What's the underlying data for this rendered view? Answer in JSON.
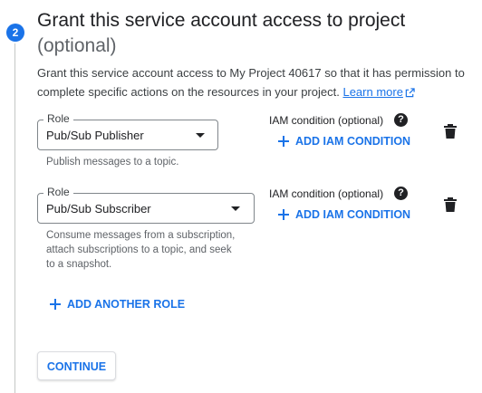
{
  "step": {
    "number": "2",
    "title": "Grant this service account access to project",
    "optional": "(optional)",
    "description_text": "Grant this service account access to My Project 40617 so that it has permission to complete specific actions on the resources in your project.",
    "learn_more": "Learn more"
  },
  "roles": [
    {
      "label": "Role",
      "value": "Pub/Sub Publisher",
      "hint": "Publish messages to a topic.",
      "iam_condition_label": "IAM condition (optional)",
      "add_iam_condition": "ADD IAM CONDITION",
      "help_glyph": "?"
    },
    {
      "label": "Role",
      "value": "Pub/Sub Subscriber",
      "hint": "Consume messages from a subscription, attach subscriptions to a topic, and seek to a snapshot.",
      "iam_condition_label": "IAM condition (optional)",
      "add_iam_condition": "ADD IAM CONDITION",
      "help_glyph": "?"
    }
  ],
  "add_another_role": "ADD ANOTHER ROLE",
  "continue_label": "CONTINUE",
  "colors": {
    "accent": "#1a73e8",
    "text": "#202124",
    "secondary_text": "#5f6368",
    "border": "#80868b"
  },
  "icons": {
    "plus": "plus-icon",
    "help": "help-icon",
    "delete": "trash-icon",
    "dropdown": "dropdown-arrow-icon",
    "external_link": "external-link-icon"
  }
}
